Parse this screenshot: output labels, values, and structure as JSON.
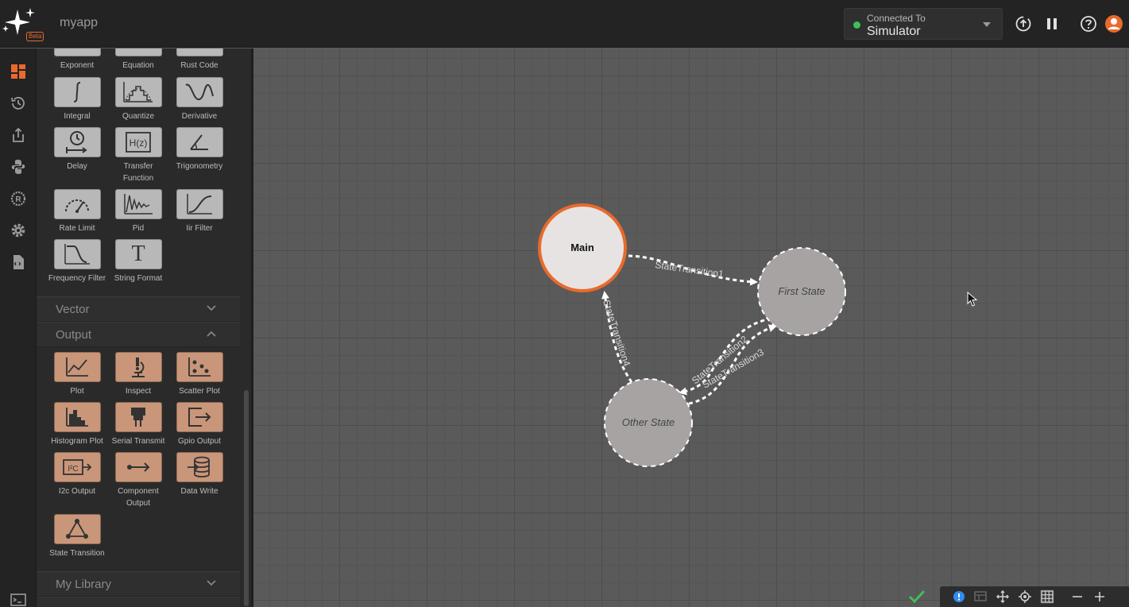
{
  "header": {
    "beta_label": "Beta",
    "app_name": "myapp",
    "connection": {
      "caption": "Connected To",
      "target": "Simulator",
      "status_color": "#3fbf5a"
    }
  },
  "rail": {
    "items": [
      "dashboard-icon",
      "history-icon",
      "export-icon",
      "python-icon",
      "rust-icon",
      "settings-icon",
      "document-icon",
      "terminal-icon"
    ],
    "active_color": "#e86a2c"
  },
  "palette": {
    "top_row": [
      "Exponent",
      "Equation",
      "Rust Code"
    ],
    "math_blocks": [
      {
        "label": "Integral",
        "icon": "integral-icon"
      },
      {
        "label": "Quantize",
        "icon": "quantize-icon"
      },
      {
        "label": "Derivative",
        "icon": "derivative-icon"
      },
      {
        "label": "Delay",
        "icon": "delay-icon"
      },
      {
        "label": "Transfer Function",
        "icon": "transfer-function-icon",
        "glyph": "H(z)"
      },
      {
        "label": "Trigonometry",
        "icon": "trigonometry-icon"
      },
      {
        "label": "Rate Limit",
        "icon": "rate-limit-icon"
      },
      {
        "label": "Pid",
        "icon": "pid-icon"
      },
      {
        "label": "Iir Filter",
        "icon": "iir-filter-icon"
      },
      {
        "label": "Frequency Filter",
        "icon": "frequency-filter-icon"
      },
      {
        "label": "String Format",
        "icon": "string-format-icon",
        "glyph": "T"
      }
    ],
    "sections": {
      "vector": "Vector",
      "output": "Output",
      "library": "My Library"
    },
    "output_blocks": [
      {
        "label": "Plot",
        "icon": "plot-icon"
      },
      {
        "label": "Inspect",
        "icon": "inspect-icon"
      },
      {
        "label": "Scatter Plot",
        "icon": "scatter-plot-icon"
      },
      {
        "label": "Histogram Plot",
        "icon": "histogram-plot-icon"
      },
      {
        "label": "Serial Transmit",
        "icon": "serial-transmit-icon"
      },
      {
        "label": "Gpio Output",
        "icon": "gpio-output-icon"
      },
      {
        "label": "I2c Output",
        "icon": "i2c-output-icon",
        "glyph": "I²C"
      },
      {
        "label": "Component Output",
        "icon": "component-output-icon"
      },
      {
        "label": "Data Write",
        "icon": "data-write-icon"
      },
      {
        "label": "State Transition",
        "icon": "state-transition-icon"
      }
    ]
  },
  "canvas": {
    "states": {
      "main": "Main",
      "first": "First State",
      "other": "Other State"
    },
    "transitions": {
      "t1": "StateTransition1",
      "t2": "StateTransition2",
      "t3": "StateTransition3",
      "t4": "StateTransition4"
    },
    "accent": "#e86a2c"
  },
  "bottombar": {
    "icons": [
      "check-icon",
      "info-icon",
      "table-icon",
      "pan-icon",
      "center-icon",
      "grid-icon",
      "zoom-out-icon",
      "zoom-in-icon"
    ]
  }
}
